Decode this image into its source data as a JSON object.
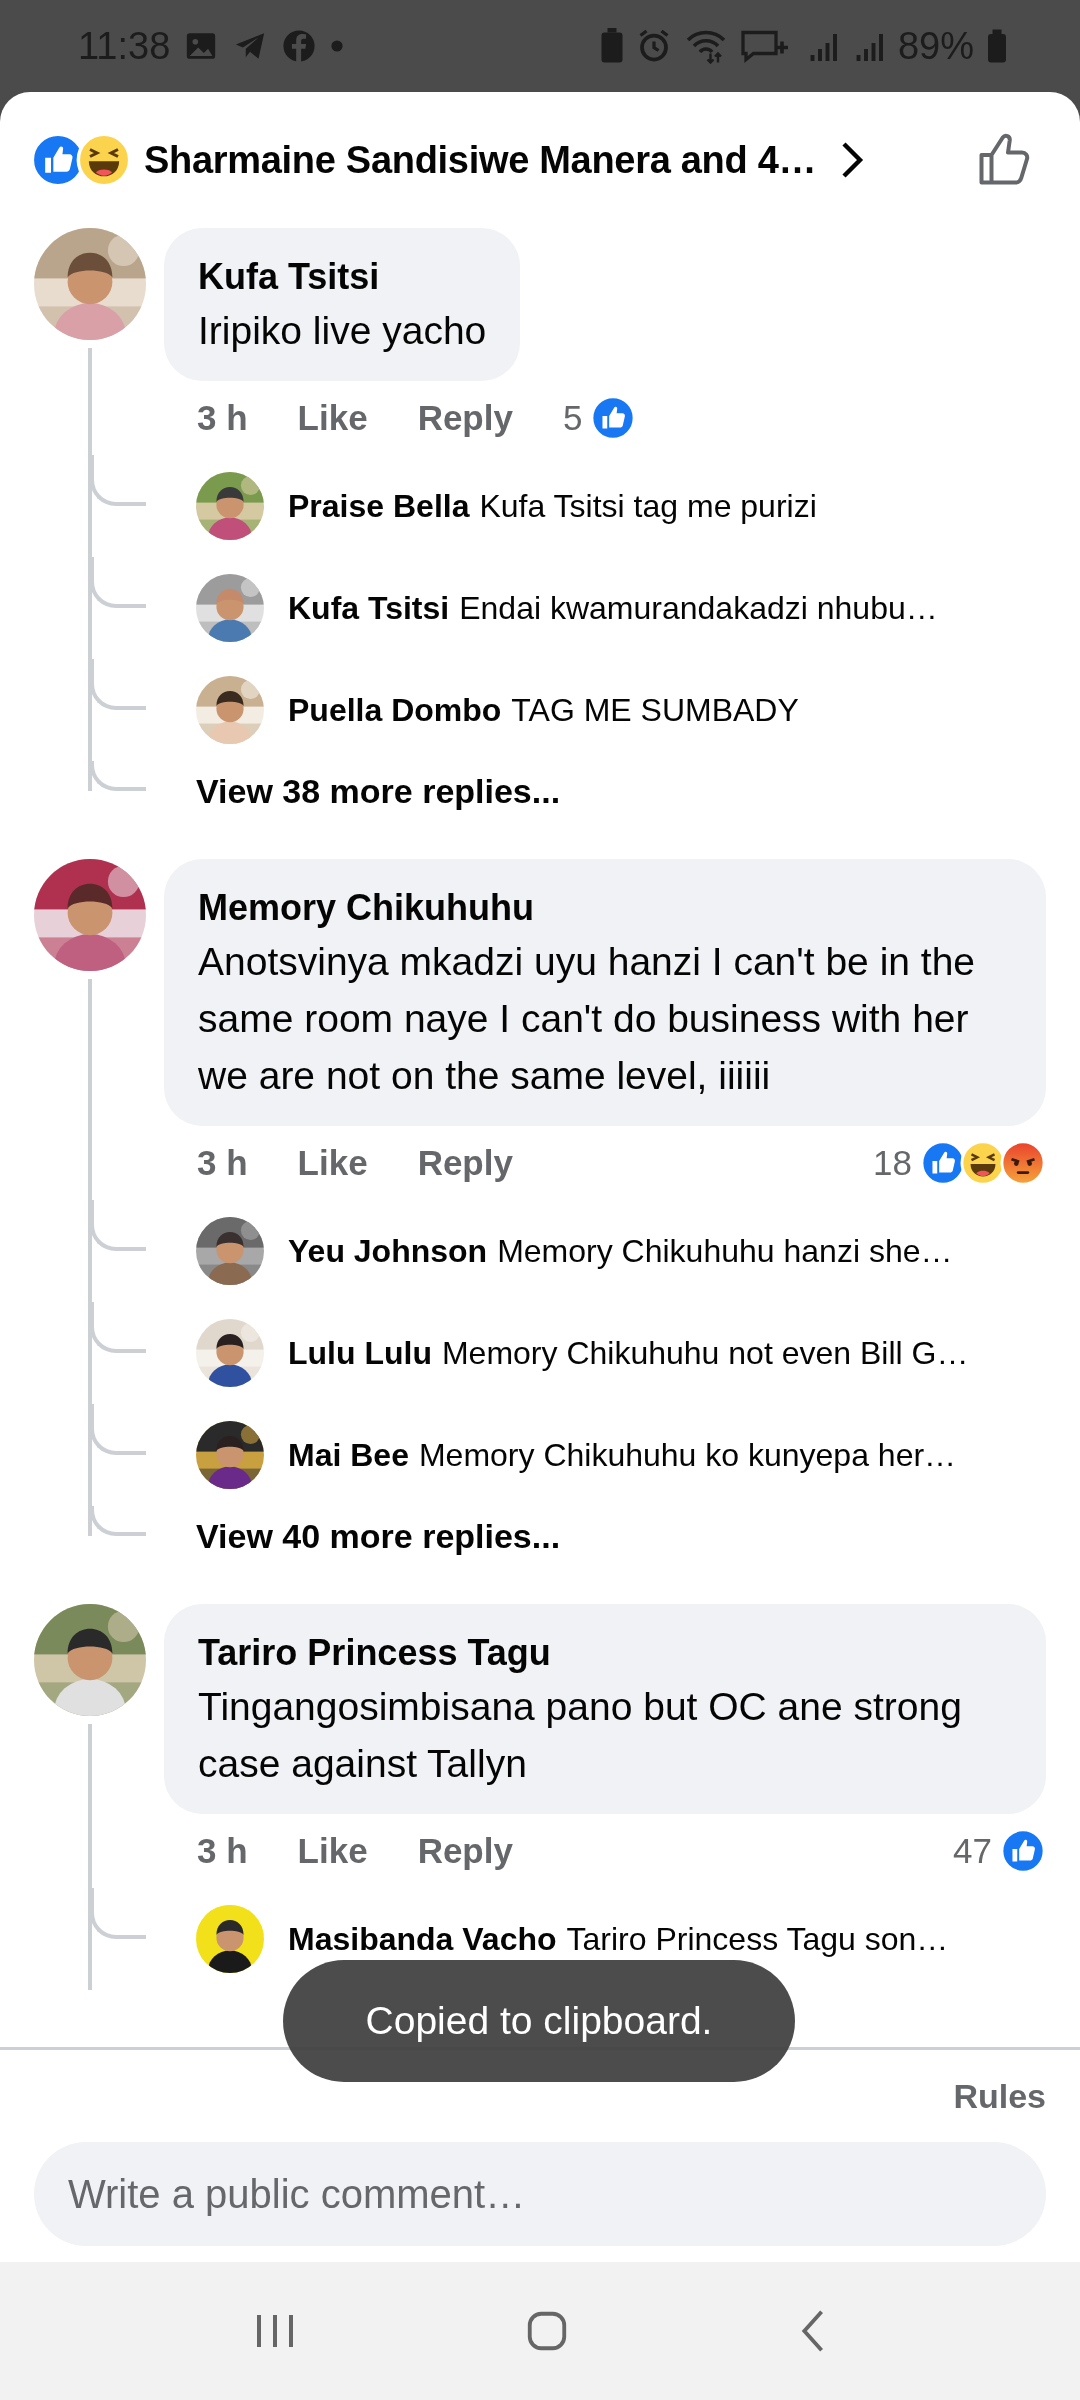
{
  "status_bar": {
    "time": "11:38",
    "battery": "89%"
  },
  "header": {
    "title": "Sharmaine Sandisiwe Manera and 4…",
    "reactions": [
      {
        "kind": "like"
      },
      {
        "kind": "haha"
      }
    ]
  },
  "comments": [
    {
      "author": "Kufa Tsitsi",
      "text": "Iripiko live yacho",
      "time": "3 h",
      "like": "Like",
      "reply": "Reply",
      "reaction_count": "5",
      "reactions": [
        {
          "kind": "like"
        }
      ],
      "replies": [
        {
          "author": "Praise Bella",
          "text": "Kufa Tsitsi tag me purizi"
        },
        {
          "author": "Kufa Tsitsi",
          "text": "Endai kwamurandakadzi nhubu…"
        },
        {
          "author": "Puella Dombo",
          "text": "TAG ME SUMBADY"
        }
      ],
      "more_replies": "View 38 more replies..."
    },
    {
      "author": "Memory Chikuhuhu",
      "text": "Anotsvinya mkadzi uyu hanzi I can't be in the same room naye I can't do business with her we are not on the same level, iiiiii",
      "time": "3 h",
      "like": "Like",
      "reply": "Reply",
      "reaction_count": "18",
      "reactions": [
        {
          "kind": "like"
        },
        {
          "kind": "haha"
        },
        {
          "kind": "angry"
        }
      ],
      "replies": [
        {
          "author": "Yeu Johnson",
          "text": "Memory Chikuhuhu hanzi she…"
        },
        {
          "author": "Lulu Lulu",
          "text": "Memory Chikuhuhu not even Bill G…"
        },
        {
          "author": "Mai Bee",
          "text": "Memory Chikuhuhu ko kunyepa her…"
        }
      ],
      "more_replies": "View 40 more replies..."
    },
    {
      "author": "Tariro Princess Tagu",
      "text": "Tingangosimbisana pano but OC ane strong case against Tallyn",
      "time": "3 h",
      "like": "Like",
      "reply": "Reply",
      "reaction_count": "47",
      "reactions": [
        {
          "kind": "like"
        }
      ],
      "replies": [
        {
          "author": "Masibanda Vacho",
          "text": "Tariro Princess Tagu son…"
        }
      ]
    }
  ],
  "toast": "Copied to clipboard.",
  "composer": {
    "rules": "Rules",
    "placeholder": "Write a public comment…"
  }
}
